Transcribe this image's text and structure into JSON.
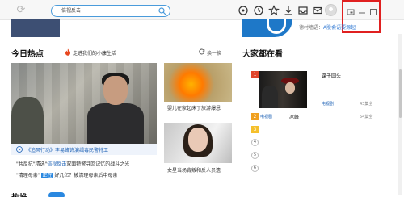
{
  "browser": {
    "search_text": "倍视反击",
    "toolbar_icons": [
      "circle-target-icon",
      "clock-icon",
      "star-icon",
      "download-icon",
      "inbox-icon",
      "mail-icon",
      "avatar"
    ],
    "window_icons": [
      "mini-mode-icon",
      "minimize-icon",
      "maximize-icon"
    ]
  },
  "banner": {
    "right_text": "德村墙语：",
    "right_link": "A股会语要源起"
  },
  "hot_today": {
    "title": "今日热点",
    "sub_link": "走进我们的小康生活",
    "refresh_label": "换一换",
    "hero_caption": "《追风行动》李易峰饰演缉毒民警特工",
    "news": [
      {
        "prefix": "\"共反抗\"精选\"",
        "link": "倍视反击",
        "suffix": "双面特警寻回记忆的战斗之光"
      },
      {
        "prefix": "\"清理母亲\"",
        "tag": "正在",
        "suffix": "好几亿？被清理母亲后中母亲"
      }
    ],
    "thumb1_caption": "婴儿在家起床了旅游爆恩",
    "thumb2_caption": "女星当场背叛和反人员遗",
    "section_bottom_fragment": "热推"
  },
  "watching": {
    "title": "大家都在看",
    "items": [
      {
        "rank": "1",
        "title": "谍子囧头",
        "tag": "电视剧",
        "count": "43集全"
      },
      {
        "rank": "2",
        "tag": "电视剧",
        "name": "冰峰",
        "count": "54集全"
      },
      {
        "rank": "3"
      },
      {
        "rank": "4"
      },
      {
        "rank": "5"
      },
      {
        "rank": "6"
      }
    ]
  }
}
